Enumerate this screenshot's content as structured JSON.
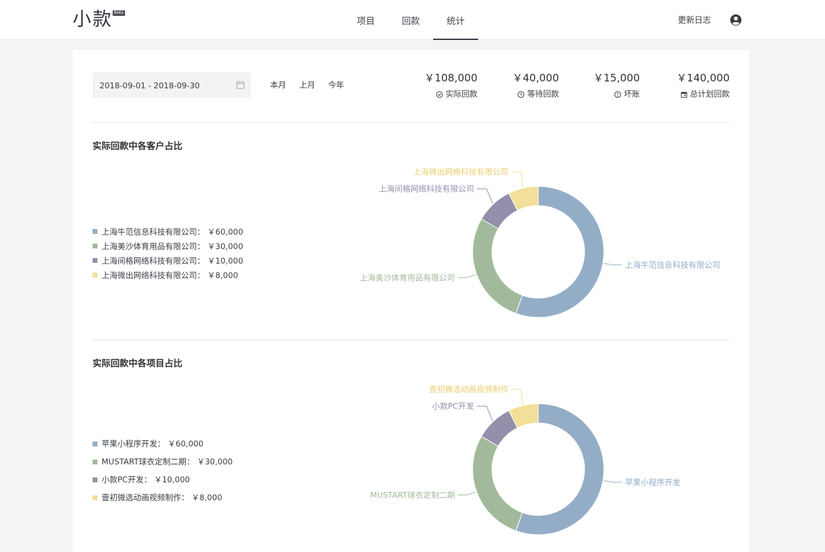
{
  "header": {
    "logo": "小款",
    "beta": "Beta",
    "nav": [
      {
        "label": "项目",
        "active": false
      },
      {
        "label": "回款",
        "active": false
      },
      {
        "label": "统计",
        "active": true
      }
    ],
    "changelog": "更新日志",
    "user_icon": "user-circle-icon"
  },
  "filter": {
    "date_range": "2018-09-01 - 2018-09-30",
    "calendar_icon": "calendar-icon",
    "quick": [
      "本月",
      "上月",
      "今年"
    ]
  },
  "stats": [
    {
      "value": "￥108,000",
      "label": "实际回款",
      "icon": "check-circle-icon"
    },
    {
      "value": "￥40,000",
      "label": "等待回款",
      "icon": "clock-icon"
    },
    {
      "value": "￥15,000",
      "label": "坏账",
      "icon": "alert-circle-icon"
    },
    {
      "value": "￥140,000",
      "label": "总计划回款",
      "icon": "calendar-icon"
    }
  ],
  "colors": {
    "blue": "#94adc7",
    "green": "#a2ba9b",
    "purple": "#9490ab",
    "yellow": "#f2df98"
  },
  "chart_data": [
    {
      "type": "pie",
      "title": "实际回款中各客户占比",
      "categories": [
        "上海牛范信息科技有限公司",
        "上海美沙体育用品有限公司",
        "上海间格网络科技有限公司",
        "上海微出网络科技有限公司"
      ],
      "values": [
        60000,
        30000,
        10000,
        8000
      ],
      "value_labels": [
        "￥60,000",
        "￥30,000",
        "￥10,000",
        "￥8,000"
      ],
      "legend": [
        "上海牛范信息科技有限公司： ￥60,000",
        "上海美沙体育用品有限公司： ￥30,000",
        "上海间格网络科技有限公司： ￥10,000",
        "上海微出网络科技有限公司： ￥8,000"
      ],
      "legend_position": "left",
      "colors": [
        "#94adc7",
        "#a2ba9b",
        "#9490ab",
        "#f2df98"
      ]
    },
    {
      "type": "pie",
      "title": "实际回款中各项目占比",
      "categories": [
        "苹果小程序开发",
        "MUSTART球衣定制二期",
        "小款PC开发",
        "壹初微选动画视频制作"
      ],
      "values": [
        60000,
        30000,
        10000,
        8000
      ],
      "value_labels": [
        "￥60,000",
        "￥30,000",
        "￥10,000",
        "￥8,000"
      ],
      "legend": [
        "苹果小程序开发： ￥60,000",
        "MUSTART球衣定制二期： ￥30,000",
        "小款PC开发： ￥10,000",
        "壹初微选动画视频制作： ￥8,000"
      ],
      "legend_position": "left",
      "colors": [
        "#94adc7",
        "#a2ba9b",
        "#9490ab",
        "#f2df98"
      ]
    }
  ]
}
